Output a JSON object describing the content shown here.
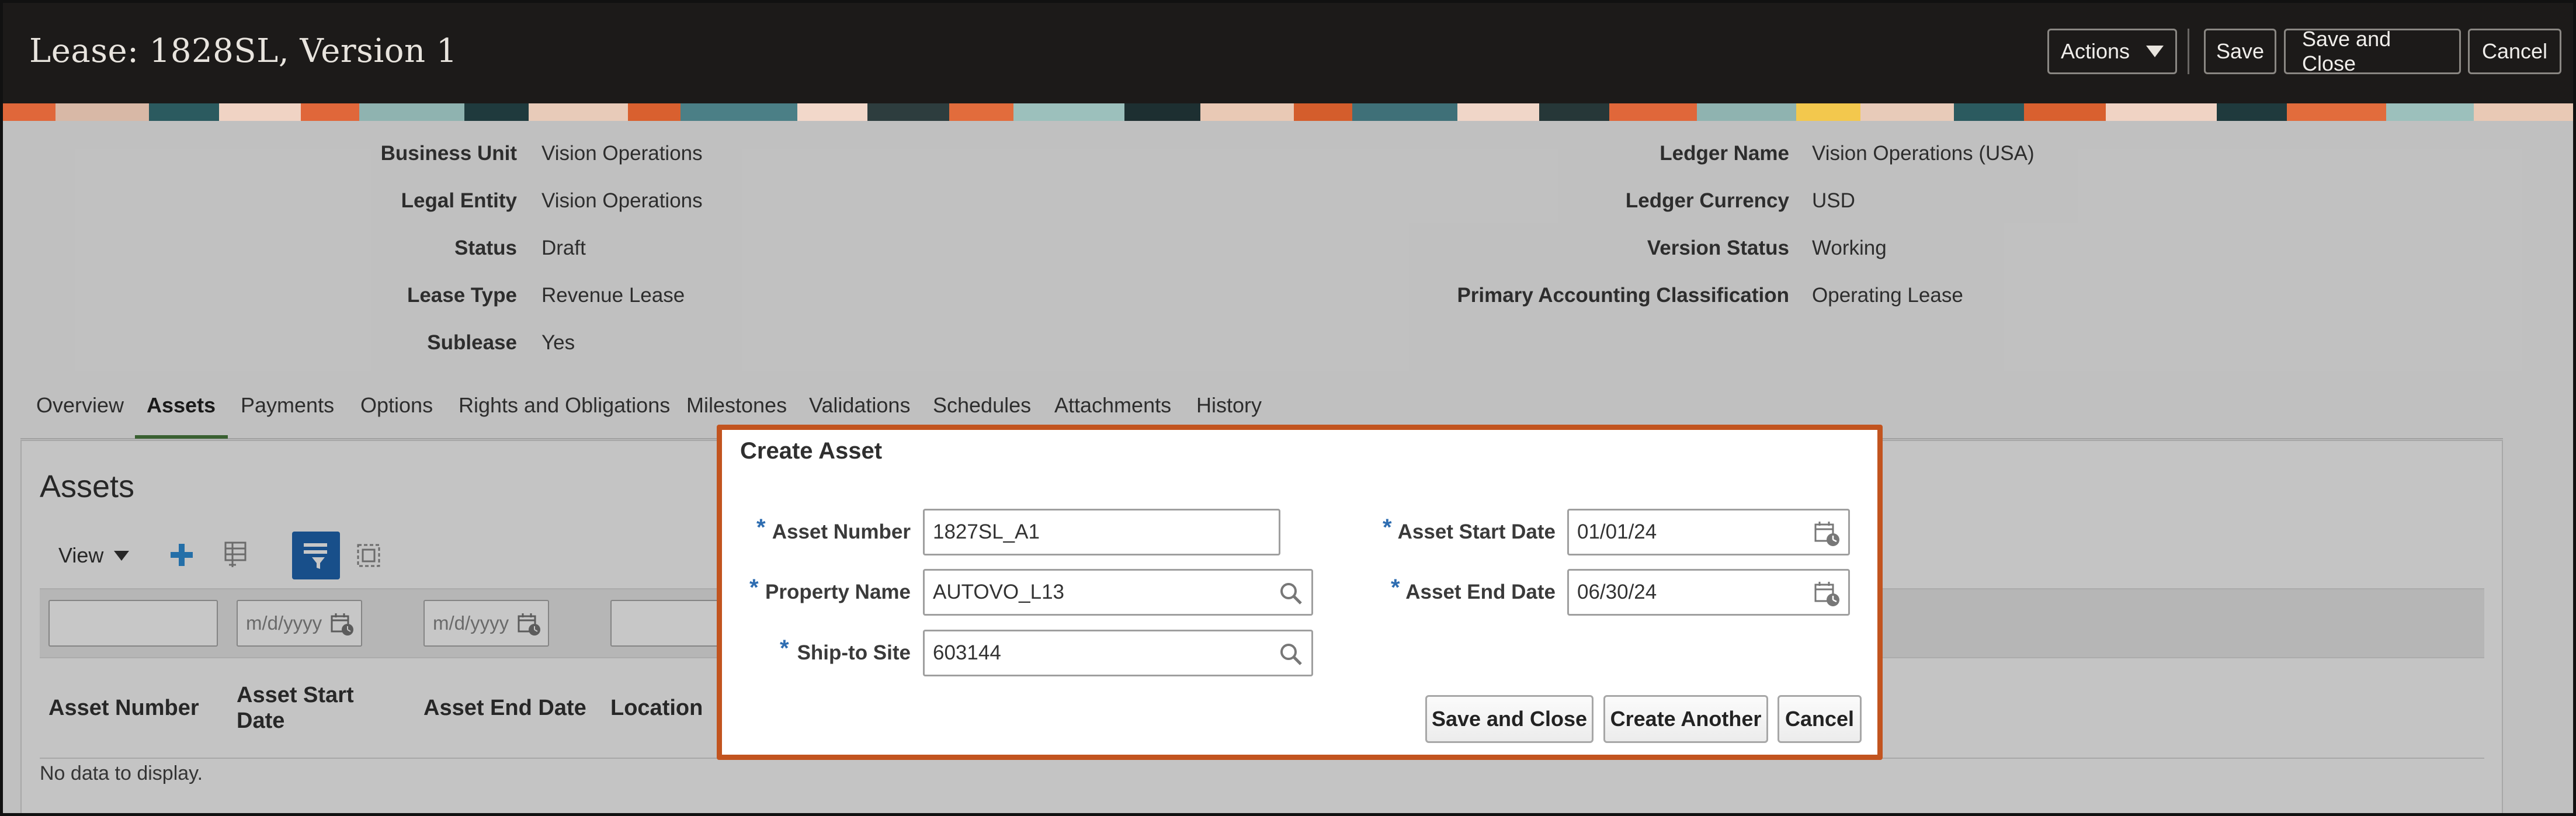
{
  "header": {
    "title": "Lease: 1828SL, Version 1",
    "actions_label": "Actions",
    "save_label": "Save",
    "save_close_label": "Save and Close",
    "cancel_label": "Cancel"
  },
  "summary": {
    "left": [
      {
        "label": "Business Unit",
        "value": "Vision Operations"
      },
      {
        "label": "Legal Entity",
        "value": "Vision Operations"
      },
      {
        "label": "Status",
        "value": "Draft"
      },
      {
        "label": "Lease Type",
        "value": "Revenue Lease"
      },
      {
        "label": "Sublease",
        "value": "Yes"
      }
    ],
    "right": [
      {
        "label": "Ledger Name",
        "value": "Vision Operations (USA)"
      },
      {
        "label": "Ledger Currency",
        "value": "USD"
      },
      {
        "label": "Version Status",
        "value": "Working"
      },
      {
        "label": "Primary Accounting Classification",
        "value": "Operating Lease"
      }
    ]
  },
  "tabs": [
    "Overview",
    "Assets",
    "Payments",
    "Options",
    "Rights and Obligations",
    "Milestones",
    "Validations",
    "Schedules",
    "Attachments",
    "History"
  ],
  "active_tab": "Assets",
  "assets_panel": {
    "title": "Assets",
    "view_label": "View",
    "date_placeholder": "m/d/yyyy",
    "columns": [
      "Asset Number",
      "Asset Start Date",
      "Asset End Date",
      "Location"
    ],
    "empty_text": "No data to display."
  },
  "dialog": {
    "title": "Create Asset",
    "asset_number_label": "Asset Number",
    "asset_number_value": "1827SL_A1",
    "property_name_label": "Property Name",
    "property_name_value": "AUTOVO_L13",
    "ship_to_label": "Ship-to Site",
    "ship_to_value": "603144",
    "start_date_label": "Asset Start Date",
    "start_date_value": "01/01/24",
    "end_date_label": "Asset End Date",
    "end_date_value": "06/30/24",
    "required_marker": "*",
    "save_close_label": "Save and Close",
    "create_another_label": "Create Another",
    "cancel_label": "Cancel"
  },
  "colors": {
    "header_bg": "#1c1a19",
    "dialog_border": "#c2541f",
    "active_tab_underline": "#4a7c3f",
    "required_asterisk": "#2e6db1",
    "add_icon": "#2f8fd8",
    "filter_toggle_bg": "#1f66b1"
  }
}
